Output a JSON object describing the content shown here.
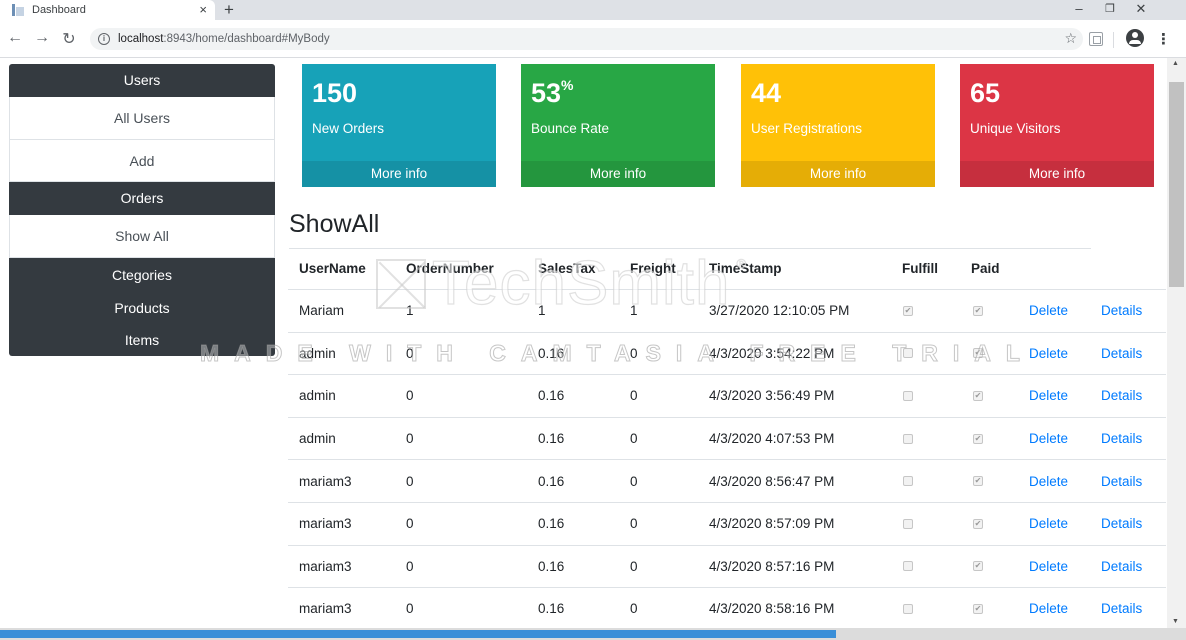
{
  "browser": {
    "tab_title": "Dashboard",
    "tab_close": "×",
    "new_tab": "+",
    "url_host": "localhost",
    "url_path": ":8943/home/dashboard#MyBody",
    "window_controls": [
      "–",
      "❐",
      "✕"
    ]
  },
  "sidebar": {
    "users_header": "Users",
    "users_items": [
      "All Users",
      "Add"
    ],
    "orders_header": "Orders",
    "orders_items": [
      "Show All"
    ],
    "bottom_items": [
      "Ctegories",
      "Products",
      "Items"
    ]
  },
  "cards": [
    {
      "value": "150",
      "suffix": "",
      "label": "New Orders",
      "footer": "More info",
      "color": "#17a2b8",
      "footer_color": "#1591a5"
    },
    {
      "value": "53",
      "suffix": "%",
      "label": "Bounce Rate",
      "footer": "More info",
      "color": "#28a745",
      "footer_color": "#24963e"
    },
    {
      "value": "44",
      "suffix": "",
      "label": "User Registrations",
      "footer": "More info",
      "color": "#ffc107",
      "footer_color": "#e5ad06"
    },
    {
      "value": "65",
      "suffix": "",
      "label": "Unique Visitors",
      "footer": "More info",
      "color": "#dc3545",
      "footer_color": "#c62f3e"
    }
  ],
  "section_title": "ShowAll",
  "table": {
    "headers": [
      "UserName",
      "OrderNumber",
      "SalesTax",
      "Freight",
      "TimeStamp",
      "Fulfill",
      "Paid"
    ],
    "rows": [
      {
        "user": "Mariam",
        "order": "1",
        "tax": "1",
        "freight": "1",
        "time": "3/27/2020 12:10:05 PM",
        "fulfill": true,
        "paid": true
      },
      {
        "user": "admin",
        "order": "0",
        "tax": "0.16",
        "freight": "0",
        "time": "4/3/2020 3:54:22 PM",
        "fulfill": false,
        "paid": true
      },
      {
        "user": "admin",
        "order": "0",
        "tax": "0.16",
        "freight": "0",
        "time": "4/3/2020 3:56:49 PM",
        "fulfill": false,
        "paid": true
      },
      {
        "user": "admin",
        "order": "0",
        "tax": "0.16",
        "freight": "0",
        "time": "4/3/2020 4:07:53 PM",
        "fulfill": false,
        "paid": true
      },
      {
        "user": "mariam3",
        "order": "0",
        "tax": "0.16",
        "freight": "0",
        "time": "4/3/2020 8:56:47 PM",
        "fulfill": false,
        "paid": true
      },
      {
        "user": "mariam3",
        "order": "0",
        "tax": "0.16",
        "freight": "0",
        "time": "4/3/2020 8:57:09 PM",
        "fulfill": false,
        "paid": true
      },
      {
        "user": "mariam3",
        "order": "0",
        "tax": "0.16",
        "freight": "0",
        "time": "4/3/2020 8:57:16 PM",
        "fulfill": false,
        "paid": true
      },
      {
        "user": "mariam3",
        "order": "0",
        "tax": "0.16",
        "freight": "0",
        "time": "4/3/2020 8:58:16 PM",
        "fulfill": false,
        "paid": true
      }
    ],
    "delete_label": "Delete",
    "details_label": "Details"
  },
  "watermark": {
    "logo": "TechSmith",
    "reg": "®",
    "text": "MADE WITH CAMTASIA FREE TRIAL"
  },
  "video_progress": 0.705
}
